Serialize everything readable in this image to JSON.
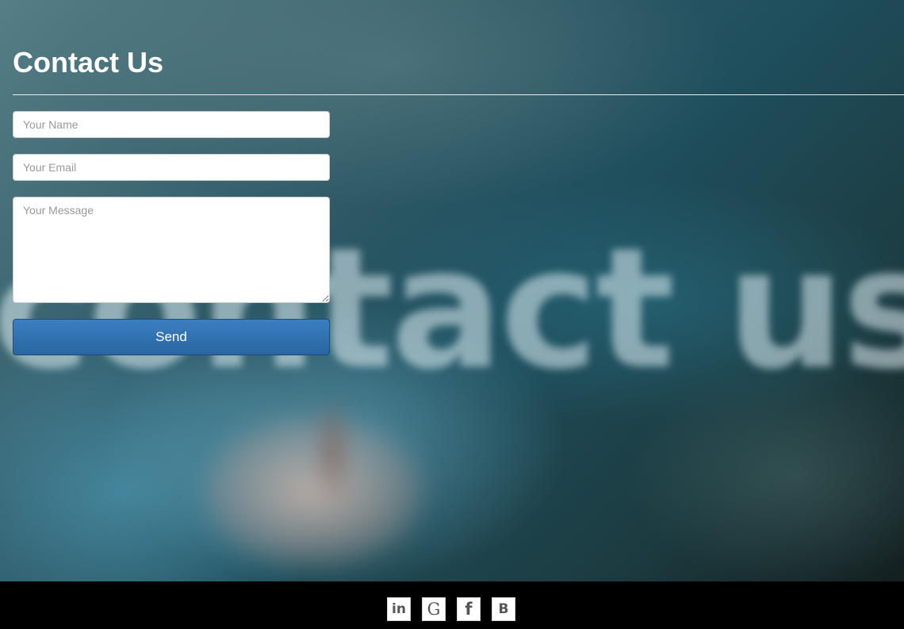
{
  "page": {
    "title": "Contact Us"
  },
  "background": {
    "word": "contact us"
  },
  "form": {
    "name_placeholder": "Your Name",
    "email_placeholder": "Your Email",
    "message_placeholder": "Your Message",
    "send_label": "Send",
    "button_color": "#2f6fad"
  },
  "footer": {
    "social": [
      {
        "icon": "linkedin-icon",
        "glyph": "in"
      },
      {
        "icon": "google-icon",
        "glyph": "G"
      },
      {
        "icon": "facebook-icon",
        "glyph": "f"
      },
      {
        "icon": "blogger-icon",
        "glyph": "B"
      }
    ]
  }
}
